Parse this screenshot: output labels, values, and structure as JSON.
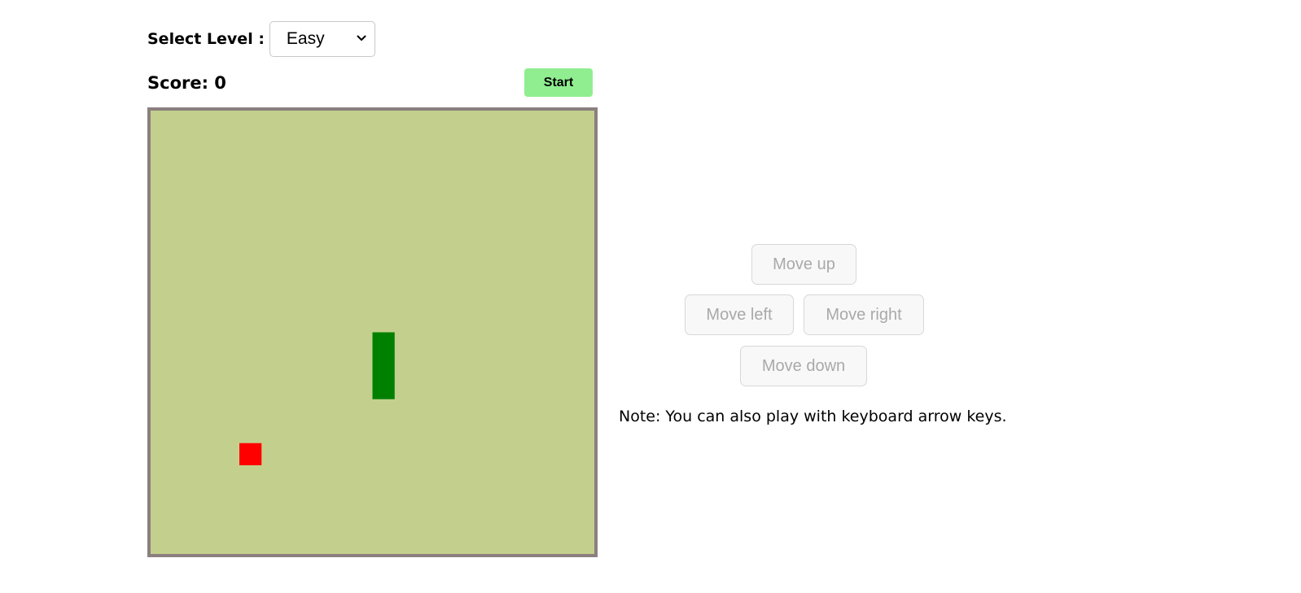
{
  "level": {
    "label": "Select Level :",
    "selected": "Easy",
    "dropdown_icon": "chevron-down-icon"
  },
  "score": {
    "text": "Score: 0",
    "value": 0
  },
  "start_button": {
    "label": "Start"
  },
  "board": {
    "grid_size": 20,
    "background_color": "#c3d08d",
    "border_color": "#8b7f7f",
    "snake_color": "#008000",
    "food_color": "#ff0000",
    "snake_cells": [
      {
        "col": 10,
        "row": 10
      },
      {
        "col": 10,
        "row": 11
      },
      {
        "col": 10,
        "row": 12
      }
    ],
    "food_cell": {
      "col": 4,
      "row": 15
    }
  },
  "controls": {
    "up_label": "Move up",
    "left_label": "Move left",
    "right_label": "Move right",
    "down_label": "Move down",
    "disabled": true
  },
  "note": "Note: You can also play with keyboard arrow keys."
}
